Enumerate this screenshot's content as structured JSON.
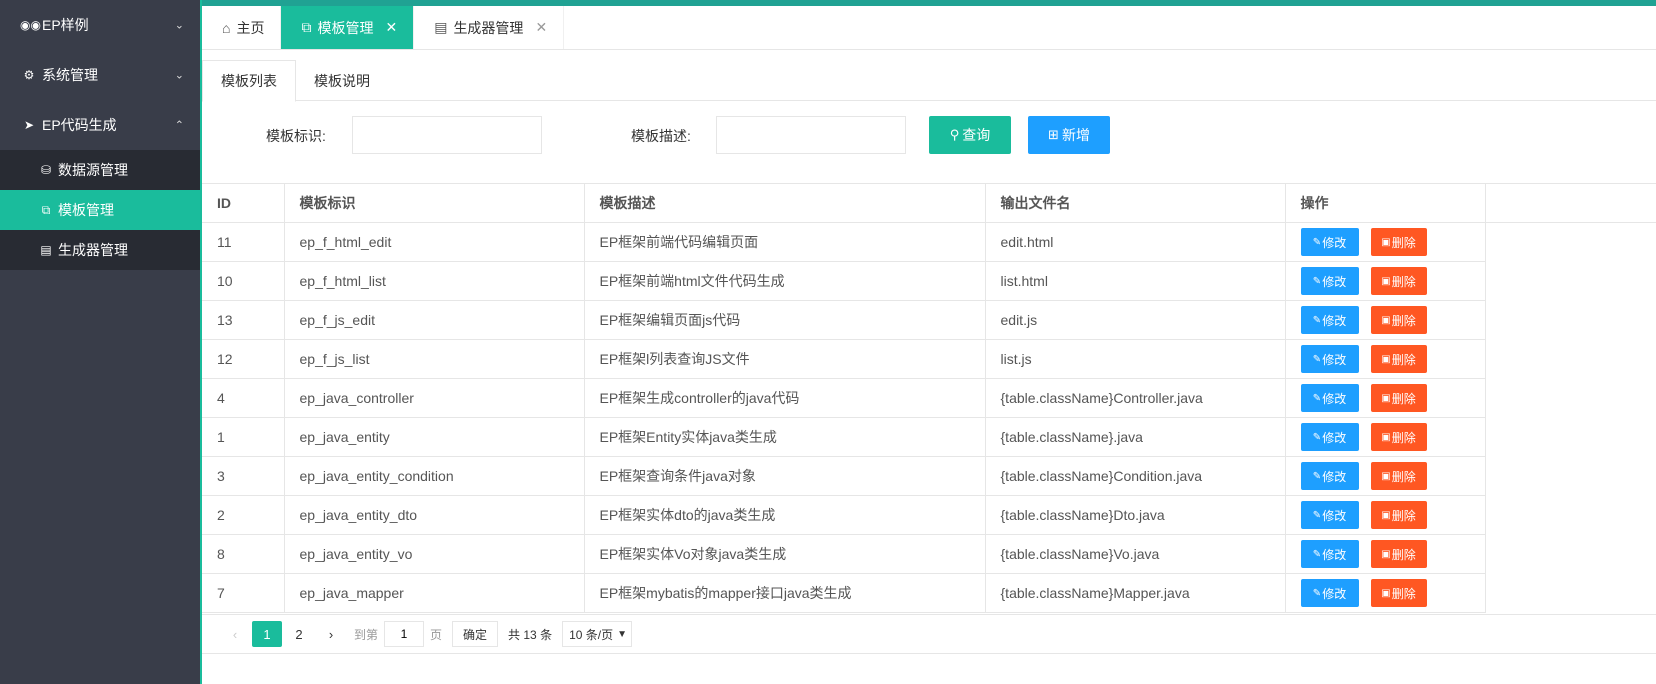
{
  "sidebar": {
    "groups": [
      {
        "label": "EP样例",
        "icon": "tripadvisor-icon",
        "chevron": "down"
      },
      {
        "label": "系统管理",
        "icon": "cogs-icon",
        "chevron": "down"
      },
      {
        "label": "EP代码生成",
        "icon": "rocket-icon",
        "chevron": "up"
      }
    ],
    "sub_items": [
      {
        "label": "数据源管理",
        "icon": "database-icon",
        "active": false
      },
      {
        "label": "模板管理",
        "icon": "copy-icon",
        "active": true
      },
      {
        "label": "生成器管理",
        "icon": "bed-icon",
        "active": false
      }
    ]
  },
  "top_tabs": [
    {
      "label": "主页",
      "icon": "home-icon",
      "closable": false,
      "active": false
    },
    {
      "label": "模板管理",
      "icon": "copy-icon",
      "closable": true,
      "active": true
    },
    {
      "label": "生成器管理",
      "icon": "bed-icon",
      "closable": true,
      "active": false
    }
  ],
  "content_tabs": [
    {
      "label": "模板列表",
      "active": true
    },
    {
      "label": "模板说明",
      "active": false
    }
  ],
  "search": {
    "id_label": "模板标识:",
    "id_value": "",
    "desc_label": "模板描述:",
    "desc_value": "",
    "query_button": "查询",
    "add_button": "新增"
  },
  "table": {
    "columns": [
      "ID",
      "模板标识",
      "模板描述",
      "输出文件名",
      "操作"
    ],
    "edit_label": "修改",
    "delete_label": "删除",
    "rows": [
      {
        "id": "11",
        "name": "ep_f_html_edit",
        "desc": "EP框架前端代码编辑页面",
        "file": "edit.html"
      },
      {
        "id": "10",
        "name": "ep_f_html_list",
        "desc": "EP框架前端html文件代码生成",
        "file": "list.html"
      },
      {
        "id": "13",
        "name": "ep_f_js_edit",
        "desc": "EP框架编辑页面js代码",
        "file": "edit.js"
      },
      {
        "id": "12",
        "name": "ep_f_js_list",
        "desc": "EP框架l列表查询JS文件",
        "file": "list.js"
      },
      {
        "id": "4",
        "name": "ep_java_controller",
        "desc": "EP框架生成controller的java代码",
        "file": "{table.className}Controller.java"
      },
      {
        "id": "1",
        "name": "ep_java_entity",
        "desc": "EP框架Entity实体java类生成",
        "file": "{table.className}.java"
      },
      {
        "id": "3",
        "name": "ep_java_entity_condition",
        "desc": "EP框架查询条件java对象",
        "file": "{table.className}Condition.java"
      },
      {
        "id": "2",
        "name": "ep_java_entity_dto",
        "desc": "EP框架实体dto的java类生成",
        "file": "{table.className}Dto.java"
      },
      {
        "id": "8",
        "name": "ep_java_entity_vo",
        "desc": "EP框架实体Vo对象java类生成",
        "file": "{table.className}Vo.java"
      },
      {
        "id": "7",
        "name": "ep_java_mapper",
        "desc": "EP框架mybatis的mapper接口java类生成",
        "file": "{table.className}Mapper.java"
      }
    ]
  },
  "pager": {
    "prev": "‹",
    "pages": [
      "1",
      "2"
    ],
    "current": "1",
    "next": "›",
    "goto_label": "到第",
    "goto_value": "1",
    "page_label": "页",
    "confirm": "确定",
    "total": "共 13 条",
    "page_size": "10 条/页"
  },
  "colors": {
    "accent": "#1ABC9C",
    "sidebar": "#393D49",
    "blue": "#1E9FFF",
    "orange": "#FF5722"
  }
}
